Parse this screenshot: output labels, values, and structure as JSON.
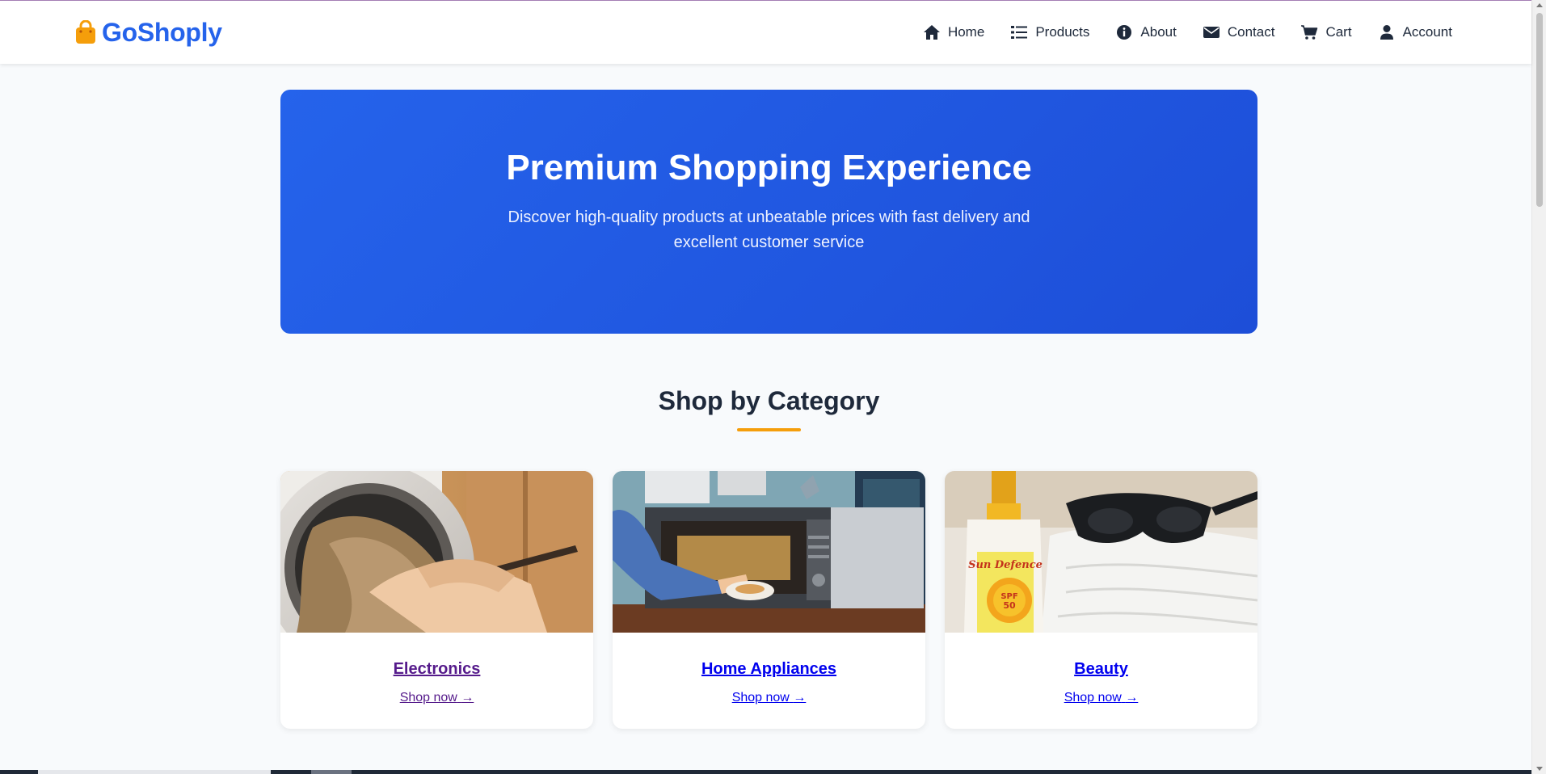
{
  "brand": {
    "name": "GoShoply",
    "icon": "shopping-bag-icon",
    "icon_color": "#f59e0b",
    "color": "#2563eb"
  },
  "nav": {
    "items": [
      {
        "label": "Home",
        "icon": "home-icon"
      },
      {
        "label": "Products",
        "icon": "list-icon"
      },
      {
        "label": "About",
        "icon": "info-icon"
      },
      {
        "label": "Contact",
        "icon": "envelope-icon"
      },
      {
        "label": "Cart",
        "icon": "cart-icon"
      },
      {
        "label": "Account",
        "icon": "user-icon"
      }
    ]
  },
  "hero": {
    "title": "Premium Shopping Experience",
    "subtitle": "Discover high-quality products at unbeatable prices with fast delivery and excellent customer service",
    "background": "#2563eb"
  },
  "categories": {
    "title": "Shop by Category",
    "accent": "#f59e0b",
    "items": [
      {
        "title": "Electronics",
        "link": "Shop now",
        "link_icon": "arrow-right-icon",
        "visited": true
      },
      {
        "title": "Home Appliances",
        "link": "Shop now",
        "link_icon": "arrow-right-icon",
        "visited": false
      },
      {
        "title": "Beauty",
        "link": "Shop now",
        "link_icon": "arrow-right-icon",
        "visited": false
      }
    ]
  },
  "product_labels": {
    "sunscreen_brand": "Sun Defence",
    "spf": "SPF",
    "spf_value": "50"
  }
}
